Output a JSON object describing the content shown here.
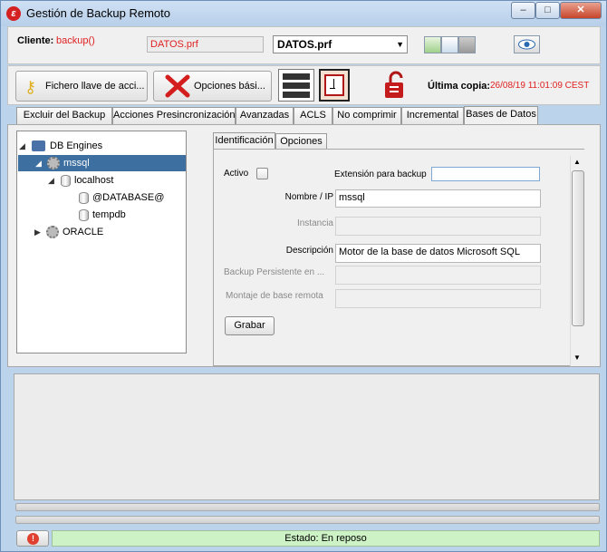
{
  "window": {
    "title": "Gestión de Backup Remoto",
    "minimize": "–",
    "maximize": "□",
    "close": "✕"
  },
  "client": {
    "label": "Cliente:",
    "name": "backup()",
    "profile_file": "DATOS.prf",
    "profile_select": "DATOS.prf"
  },
  "toolbar": {
    "key_file_button": "Fichero llave de acci...",
    "basic_options_button": "Opciones bási...",
    "last_copy_label": "Última copia:",
    "last_copy_value": "26/08/19 11:01:09 CEST"
  },
  "tabs": [
    "Excluir del Backup",
    "Acciones Presincronización",
    "Avanzadas",
    "ACLS",
    "No comprimir",
    "Incremental",
    "Bases de Datos"
  ],
  "active_tab": "Bases de Datos",
  "tree": {
    "root": "DB Engines",
    "engine1": "mssql",
    "host": "localhost",
    "db1": "@DATABASE@",
    "db2": "tempdb",
    "engine2": "ORACLE"
  },
  "subtabs": [
    "Identificación",
    "Opciones"
  ],
  "form": {
    "active_label": "Activo",
    "backup_ext_label": "Extensión para backup",
    "backup_ext_value": "",
    "name_ip_label": "Nombre / IP",
    "name_ip_value": "mssql",
    "instance_label": "Instancia",
    "instance_value": "",
    "description_label": "Descripción",
    "description_value": "Motor de la base de datos Microsoft SQL",
    "persistent_label": "Backup Persistente en ...",
    "persistent_value": "",
    "remote_mount_label": "Montaje de base remota",
    "remote_mount_value": "",
    "save_button": "Grabar"
  },
  "status": {
    "text": "Estado: En reposo"
  },
  "colors": {
    "accent_red": "#e02020",
    "selection": "#3d6fa0",
    "status_bg": "#cdf2c5"
  }
}
